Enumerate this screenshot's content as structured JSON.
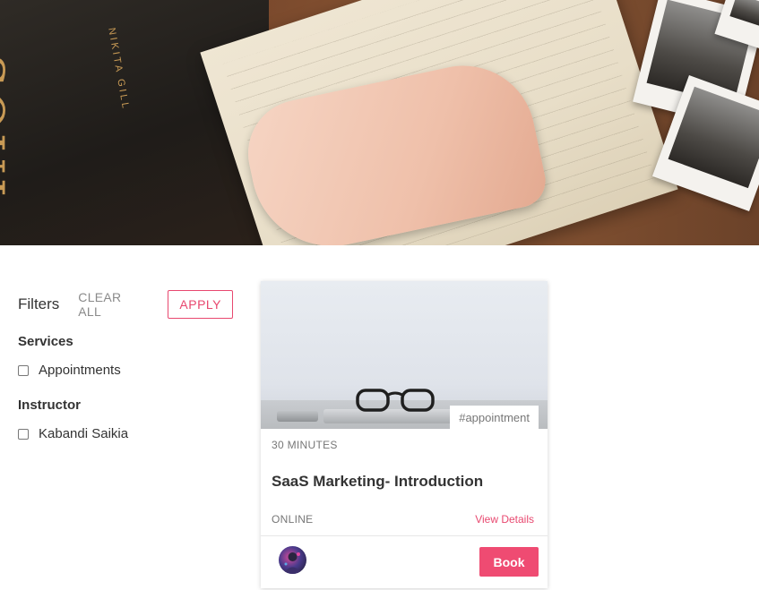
{
  "hero": {
    "book_cover_word": "SOUL",
    "book_spine_text": "NIKITA GILL"
  },
  "filters": {
    "title": "Filters",
    "clear_all": "CLEAR ALL",
    "apply": "APPLY",
    "groups": [
      {
        "title": "Services",
        "options": [
          {
            "label": "Appointments",
            "checked": false
          }
        ]
      },
      {
        "title": "Instructor",
        "options": [
          {
            "label": "Kabandi Saikia",
            "checked": false
          }
        ]
      }
    ]
  },
  "card": {
    "tag": "#appointment",
    "duration": "30 MINUTES",
    "title": "SaaS Marketing- Introduction",
    "mode": "ONLINE",
    "view_details": "View Details",
    "book": "Book"
  },
  "colors": {
    "accent": "#ef4b72",
    "accent_border": "#e8486f",
    "muted_text": "#777777"
  }
}
